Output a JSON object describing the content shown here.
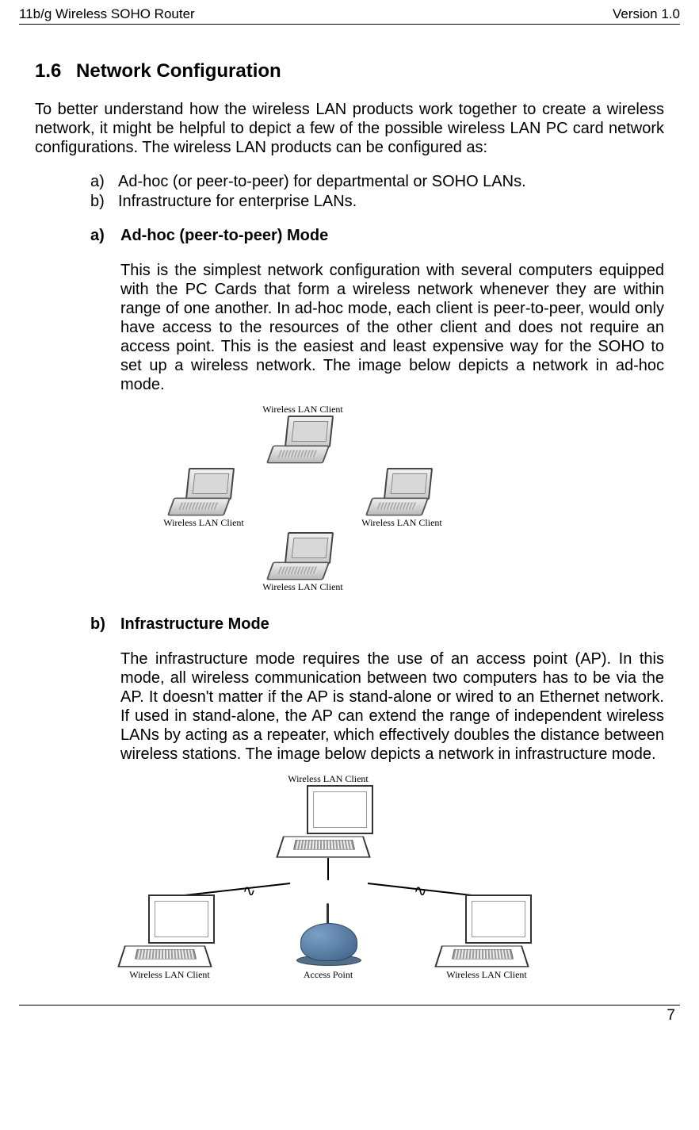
{
  "header": {
    "left": "11b/g Wireless SOHO Router",
    "right": "Version 1.0"
  },
  "section": {
    "number": "1.6",
    "title": "Network Configuration"
  },
  "intro": "To better understand how the wireless LAN products work together to create a wireless network, it might be helpful to depict a few of the possible wireless LAN PC card network configurations. The wireless LAN products can be configured as:",
  "list": {
    "a": {
      "marker": "a)",
      "text": "Ad-hoc (or peer-to-peer) for departmental or SOHO LANs."
    },
    "b": {
      "marker": "b)",
      "text": "Infrastructure for enterprise LANs."
    }
  },
  "subA": {
    "marker": "a)",
    "title": "Ad-hoc (peer-to-peer) Mode",
    "body": "This is the simplest network configuration with several computers equipped with the PC Cards that form a wireless network whenever they are within range of one another.  In ad-hoc mode, each client is peer-to-peer, would only have access to the resources of the other client and does not require an access point. This is the easiest and least expensive way for the SOHO to set up a wireless network. The image below depicts a network in ad-hoc mode."
  },
  "subB": {
    "marker": "b)",
    "title": "Infrastructure Mode",
    "body": "The infrastructure mode requires the use of an access point (AP). In this mode, all wireless communication between two computers has to be via the AP. It doesn't matter if the AP is stand-alone or wired to an Ethernet network. If used in stand-alone, the AP can extend the range of independent wireless LANs by acting as a repeater, which effectively doubles the distance between wireless stations.  The image below depicts a network in infrastructure mode."
  },
  "diag1": {
    "label_top": "Wireless LAN Client",
    "label_left": "Wireless LAN Client",
    "label_right": "Wireless LAN Client",
    "label_bottom": "Wireless LAN Client"
  },
  "diag2": {
    "label_top": "Wireless LAN Client",
    "label_bl": "Wireless LAN Client",
    "label_mid": "Access Point",
    "label_br": "Wireless LAN Client"
  },
  "page_num": "7"
}
